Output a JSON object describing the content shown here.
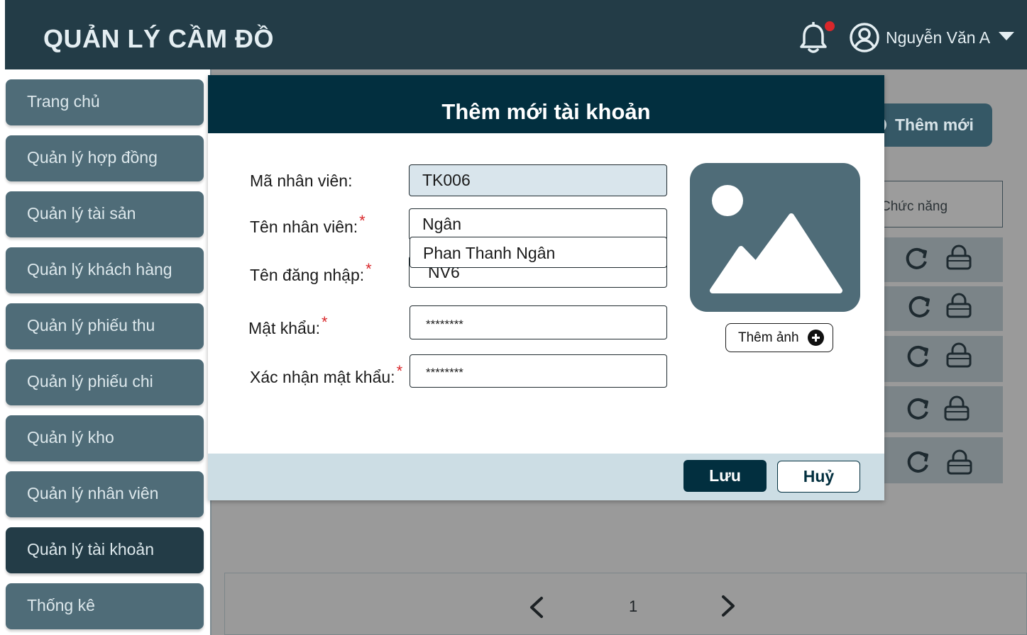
{
  "header": {
    "app_title": "QUẢN LÝ CẦM ĐỒ",
    "user_name": "Nguyễn Văn A",
    "notification_badge_color": "#d9272b"
  },
  "sidebar": {
    "items": [
      {
        "label": "Trang chủ"
      },
      {
        "label": "Quản lý hợp đồng"
      },
      {
        "label": "Quản lý tài sản"
      },
      {
        "label": "Quản lý khách hàng"
      },
      {
        "label": "Quản lý phiếu thu"
      },
      {
        "label": "Quản lý phiếu chi"
      },
      {
        "label": "Quản lý kho"
      },
      {
        "label": "Quản lý nhân viên"
      },
      {
        "label": "Quản lý tài khoản",
        "active": true
      },
      {
        "label": "Thống kê"
      }
    ]
  },
  "main": {
    "add_new_label": "Thêm mới",
    "function_column_header": "Chức năng",
    "row_icons": [
      "edit-icon",
      "reset-icon",
      "lock-icon"
    ],
    "pagination": {
      "current_page": "1"
    }
  },
  "modal": {
    "title": "Thêm mới tài khoản",
    "fields": {
      "employee_code": {
        "label": "Mã nhân viên:",
        "value": "TK006"
      },
      "employee_name": {
        "label": "Tên nhân viên:",
        "value": "Ngân",
        "required_mark": "*"
      },
      "username": {
        "label": "Tên đăng nhập:",
        "value": "NV6",
        "required_mark": "*"
      },
      "password": {
        "label": "Mật khẩu:",
        "value": "********",
        "required_mark": "*"
      },
      "confirm_password": {
        "label": "Xác nhận mật khẩu:",
        "value": "********",
        "required_mark": "*"
      }
    },
    "autocomplete_suggestion": "Phan Thanh Ngân",
    "add_image_label": "Thêm ảnh",
    "save_label": "Lưu",
    "cancel_label": "Huỷ"
  },
  "colors": {
    "header_bg": "#233c47",
    "sidebar_item": "#4f6c78",
    "modal_header": "#022f3f",
    "modal_footer": "#ccdde4",
    "required": "#d9272b"
  }
}
